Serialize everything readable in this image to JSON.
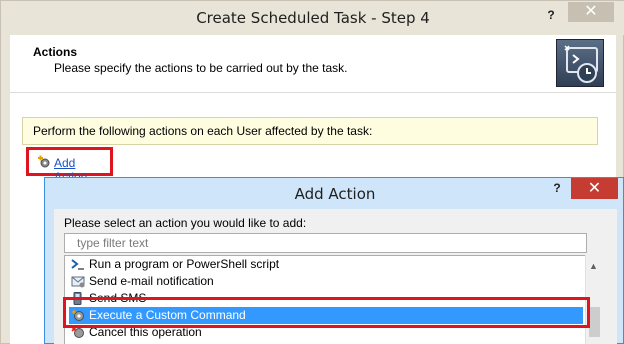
{
  "outer_window": {
    "title": "Create Scheduled Task - Step 4",
    "help_label": "?",
    "close_label": "✕",
    "header_title": "Actions",
    "header_subtitle": "Please specify the actions to be carried out by the task.",
    "perform_text": "Perform the following actions on each User affected by the task:",
    "add_action_link": "Add Action"
  },
  "dialog": {
    "title": "Add Action",
    "help_label": "?",
    "close_label": "✕",
    "prompt": "Please select an action you would like to add:",
    "filter_placeholder": "type filter text",
    "selected_index": 3,
    "items": [
      {
        "label": "Run a program or PowerShell script",
        "icon": "powershell-icon"
      },
      {
        "label": "Send e-mail notification",
        "icon": "email-icon"
      },
      {
        "label": "Send SMS",
        "icon": "sms-icon"
      },
      {
        "label": "Execute a Custom Command",
        "icon": "gear-icon"
      },
      {
        "label": "Cancel this operation",
        "icon": "cancel-icon"
      }
    ]
  },
  "colors": {
    "selection": "#3399ff",
    "highlight_frame": "#e0141e",
    "link": "#1a51c8",
    "dialog_close": "#c43c32"
  }
}
